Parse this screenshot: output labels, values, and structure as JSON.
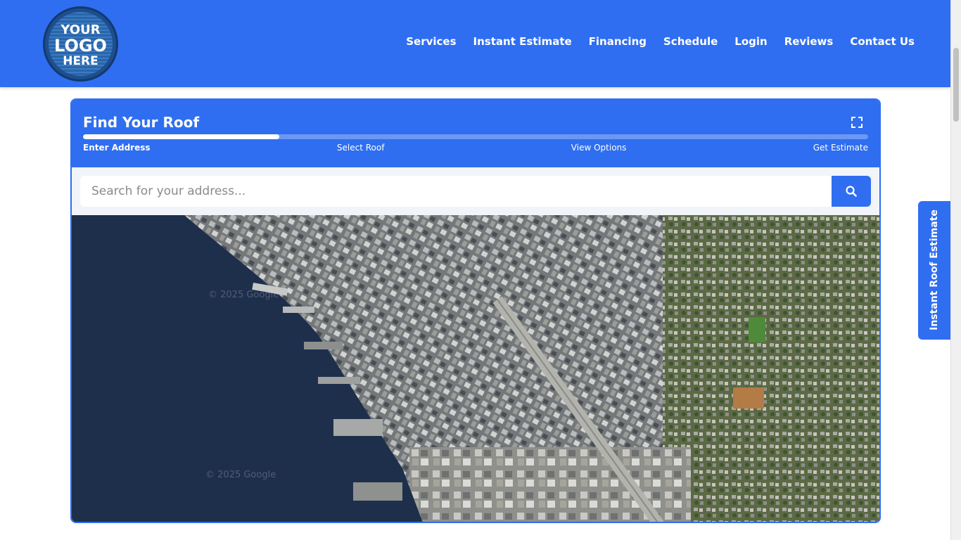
{
  "header": {
    "logo_text": [
      "YOUR",
      "LOGO",
      "HERE"
    ],
    "nav": [
      "Services",
      "Instant Estimate",
      "Financing",
      "Schedule",
      "Login",
      "Reviews",
      "Contact Us"
    ]
  },
  "finder": {
    "title": "Find Your Roof",
    "progress_fraction": 0.25,
    "steps": [
      "Enter Address",
      "Select Roof",
      "View Options",
      "Get Estimate"
    ],
    "active_step": 0,
    "fullscreen_icon": "expand-icon"
  },
  "search": {
    "placeholder": "Search for your address...",
    "value": "",
    "button_icon": "search-icon"
  },
  "map": {
    "watermarks": [
      "© 2025 Google",
      "© 2025 Google"
    ]
  },
  "side_tab": {
    "label": "Instant Roof Estimate"
  },
  "colors": {
    "brand": "#2f6ef0",
    "water": "#1e2f4c",
    "white": "#ffffff"
  }
}
